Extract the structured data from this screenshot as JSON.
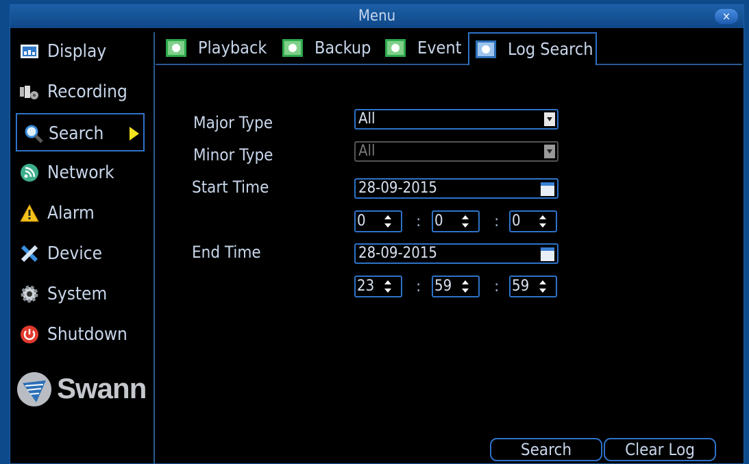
{
  "window": {
    "title": "Menu",
    "close_label": "×"
  },
  "sidebar": {
    "items": [
      {
        "label": "Display",
        "icon": "display-icon"
      },
      {
        "label": "Recording",
        "icon": "recording-icon"
      },
      {
        "label": "Search",
        "icon": "search-icon",
        "active": true
      },
      {
        "label": "Network",
        "icon": "network-icon"
      },
      {
        "label": "Alarm",
        "icon": "alarm-icon"
      },
      {
        "label": "Device",
        "icon": "device-icon"
      },
      {
        "label": "System",
        "icon": "system-icon"
      },
      {
        "label": "Shutdown",
        "icon": "power-icon"
      }
    ],
    "logo": "Swann"
  },
  "tabs": [
    {
      "label": "Playback"
    },
    {
      "label": "Backup"
    },
    {
      "label": "Event"
    },
    {
      "label": "Log Search",
      "active": true
    }
  ],
  "form": {
    "major_type": {
      "label": "Major Type",
      "value": "All"
    },
    "minor_type": {
      "label": "Minor Type",
      "value": "All",
      "disabled": true
    },
    "start_time": {
      "label": "Start Time",
      "date": "28-09-2015",
      "hour": "0",
      "minute": "0",
      "second": "0"
    },
    "end_time": {
      "label": "End Time",
      "date": "28-09-2015",
      "hour": "23",
      "minute": "59",
      "second": "59"
    },
    "time_separator": ":"
  },
  "buttons": {
    "search": "Search",
    "clear_log": "Clear Log"
  },
  "colors": {
    "background": "#0d4a8c",
    "accent": "#2e73c9",
    "arrow": "#f2e21f"
  }
}
